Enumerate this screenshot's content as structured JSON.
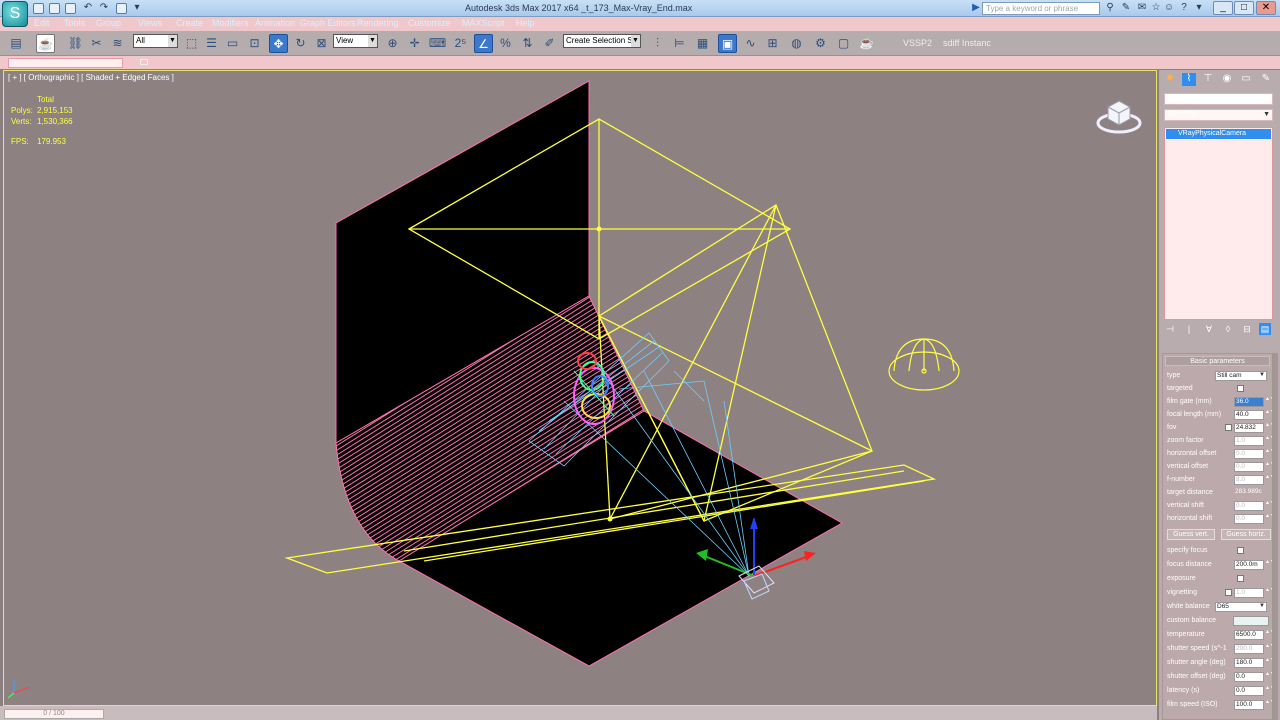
{
  "titlebar": {
    "window_title": "Autodesk 3ds Max 2017 x64    _t_173_Max-Vray_End.max",
    "search_placeholder": "Type a keyword or phrase",
    "logo_glyph": "S"
  },
  "menubar": {
    "items": [
      "Edit",
      "Tools",
      "Group",
      "Views",
      "Create",
      "Modifiers",
      "Animation",
      "Graph Editors",
      "Rendering",
      "Customize",
      "MAXScript",
      "Help"
    ]
  },
  "toolbar": {
    "selection_filter": "All",
    "ref_coord": "View",
    "named_selection": "Create Selection Se",
    "plugin_label_1": "VSSP2",
    "plugin_label_2": "sdiff Instanc"
  },
  "viewport": {
    "label": "[ + ] [ Orthographic ] [ Shaded + Edged Faces ]",
    "stats": {
      "total_label": "Total",
      "polys_label": "Polys:",
      "polys_value": "2,915,153",
      "verts_label": "Verts:",
      "verts_value": "1,530,366",
      "fps_label": "FPS:",
      "fps_value": "179.953"
    }
  },
  "command_panel": {
    "name_field": "VRayPhysicalCamera001",
    "color_dropdown": "VRayPhy",
    "object_list": [
      "VRayPhysicalCamera"
    ],
    "rollout_title": "Basic parameters",
    "params": [
      {
        "label": "type",
        "value": "Still cam",
        "kind": "dropdown"
      },
      {
        "label": "targeted",
        "value": "",
        "kind": "check"
      },
      {
        "label": "film gate (mm)",
        "value": "36.0",
        "kind": "spinner-sel"
      },
      {
        "label": "focal length (mm)",
        "value": "40.0",
        "kind": "spinner"
      },
      {
        "label": "fov",
        "value": "24.832",
        "kind": "check-spinner"
      },
      {
        "label": "zoom factor",
        "value": "1.0",
        "kind": "spinner-dim"
      },
      {
        "label": "horizontal offset",
        "value": "0.0",
        "kind": "spinner-dim"
      },
      {
        "label": "vertical offset",
        "value": "0.0",
        "kind": "spinner-dim"
      },
      {
        "label": "f-number",
        "value": "8.0",
        "kind": "spinner-dim"
      },
      {
        "label": "target distance",
        "value": "283.989c",
        "kind": "text"
      },
      {
        "label": "vertical shift",
        "value": "0.0",
        "kind": "spinner-dim"
      },
      {
        "label": "horizontal shift",
        "value": "0.0",
        "kind": "spinner-dim"
      }
    ],
    "guess_vert_label": "Guess vert.",
    "guess_horiz_label": "Guess horiz.",
    "params2": [
      {
        "label": "specify focus",
        "value": "",
        "kind": "check"
      },
      {
        "label": "focus distance",
        "value": "200.0m",
        "kind": "spinner"
      },
      {
        "label": "exposure",
        "value": "",
        "kind": "check"
      },
      {
        "label": "vignetting",
        "value": "1.0",
        "kind": "check-spinner-dim"
      },
      {
        "label": "white balance",
        "value": "D65",
        "kind": "dropdown"
      },
      {
        "label": "custom balance",
        "value": "",
        "kind": "color"
      },
      {
        "label": "temperature",
        "value": "6500.0",
        "kind": "spinner"
      },
      {
        "label": "shutter speed (s^-1",
        "value": "200.0",
        "kind": "spinner-dim"
      },
      {
        "label": "shutter angle (deg)",
        "value": "180.0",
        "kind": "spinner"
      },
      {
        "label": "shutter offset (deg)",
        "value": "0.0",
        "kind": "spinner"
      },
      {
        "label": "latency (s)",
        "value": "0.0",
        "kind": "spinner"
      },
      {
        "label": "film speed (ISO)",
        "value": "100.0",
        "kind": "spinner"
      }
    ]
  },
  "bottom": {
    "time_slider": "0 / 100"
  },
  "colors": {
    "viewport_bg": "#8d8182",
    "wire_yellow": "#ffff40",
    "wire_cyan": "#6ad0ff",
    "wire_pink": "#ff70b0",
    "selection_blue": "#2f8ef0"
  }
}
